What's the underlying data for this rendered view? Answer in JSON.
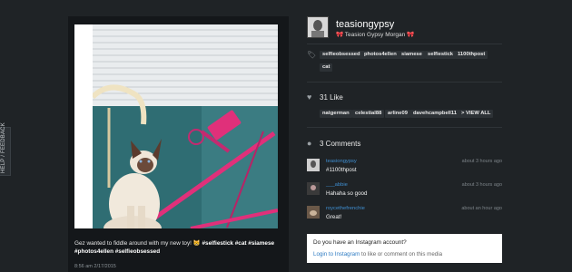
{
  "help_tab": {
    "label": "HELP / FEEDBACK"
  },
  "media": {
    "caption_text": "Gez wanted to fiddle around with my new toy!",
    "caption_emoji": "😸",
    "caption_tags": "#selfiestick #cat #siamese #photos4ellen #selfieobsessed",
    "timestamp": "8:56 am 2/17/2015"
  },
  "profile": {
    "username": "teasiongypsy",
    "bow_left": "🎀",
    "full_name": "Teasion Gypsy Morgan",
    "bow_right": "🎀"
  },
  "tags": {
    "icon": "tag-icon",
    "items": [
      "selfieobsessed",
      "photos4ellen",
      "siamese",
      "selfiestick",
      "1100thpost",
      "cat"
    ]
  },
  "likes": {
    "icon": "heart-icon",
    "count_label": "31 Like",
    "users": [
      "natgerman",
      "celestial88",
      "arline09",
      "davehcampbell11"
    ],
    "view_all": "> VIEW ALL"
  },
  "comments": {
    "icon": "comment-icon",
    "count_label": "3 Comments",
    "items": [
      {
        "user": "teasiongypsy",
        "text": "#1100thpost",
        "time": "about 3 hours ago"
      },
      {
        "user": "___abbie",
        "text": "Hahaha so good",
        "time": "about 3 hours ago"
      },
      {
        "user": "roycethefrenchie",
        "text": "Great!",
        "time": "about an hour ago"
      }
    ]
  },
  "login": {
    "question": "Do you have an Instagram account?",
    "link": "Login to Instagram",
    "rest": " to like or comment on this media"
  },
  "colors": {
    "background": "#1f2326",
    "link": "#3f8fd2",
    "accent_pink": "#e0307a"
  }
}
